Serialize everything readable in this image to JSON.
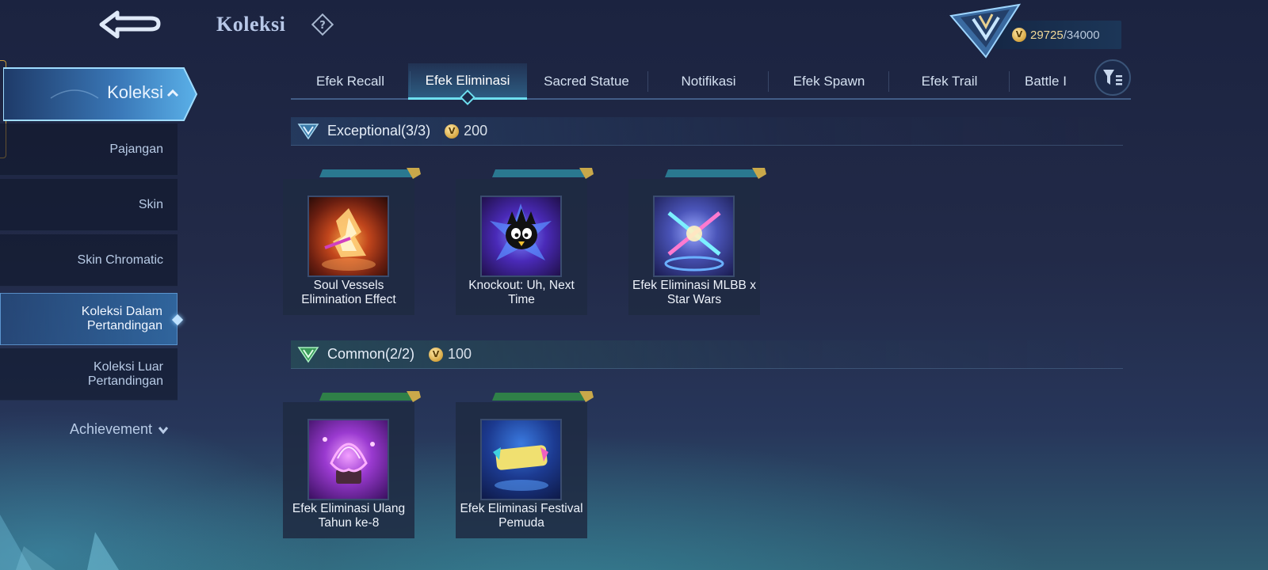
{
  "header": {
    "title": "Koleksi",
    "points_current": "29725",
    "points_max": "/34000"
  },
  "sidebar": {
    "header_label": "Koleksi",
    "items": [
      {
        "label": "Pajangan"
      },
      {
        "label": "Skin"
      },
      {
        "label": "Skin Chromatic"
      },
      {
        "label": "Koleksi Dalam Pertandingan"
      },
      {
        "label": "Koleksi Luar Pertandingan"
      }
    ],
    "achievement_label": "Achievement"
  },
  "tabs": [
    {
      "label": "Efek Recall"
    },
    {
      "label": "Efek Eliminasi"
    },
    {
      "label": "Sacred Statue"
    },
    {
      "label": "Notifikasi"
    },
    {
      "label": "Efek Spawn"
    },
    {
      "label": "Efek Trail"
    },
    {
      "label": "Battle I"
    }
  ],
  "sections": [
    {
      "title": "Exceptional(3/3)",
      "cost": "200",
      "items": [
        {
          "name": "Soul Vessels Elimination Effect"
        },
        {
          "name": "Knockout: Uh, Next Time"
        },
        {
          "name": "Efek Eliminasi MLBB x Star Wars"
        }
      ]
    },
    {
      "title": "Common(2/2)",
      "cost": "100",
      "items": [
        {
          "name": "Efek Eliminasi Ulang Tahun ke-8"
        },
        {
          "name": "Efek Eliminasi Festival Pemuda"
        }
      ]
    }
  ],
  "icons": {
    "back": "back-arrow-icon",
    "help": "question-diamond-icon",
    "coin": "v-coin-icon",
    "filter": "filter-icon",
    "rank": "rank-emblem-icon"
  },
  "colors": {
    "accent": "#6ee0f0",
    "gold": "#d6a640",
    "exceptional_ribbon": "#3a9ab0",
    "common_ribbon": "#3a9a50"
  }
}
